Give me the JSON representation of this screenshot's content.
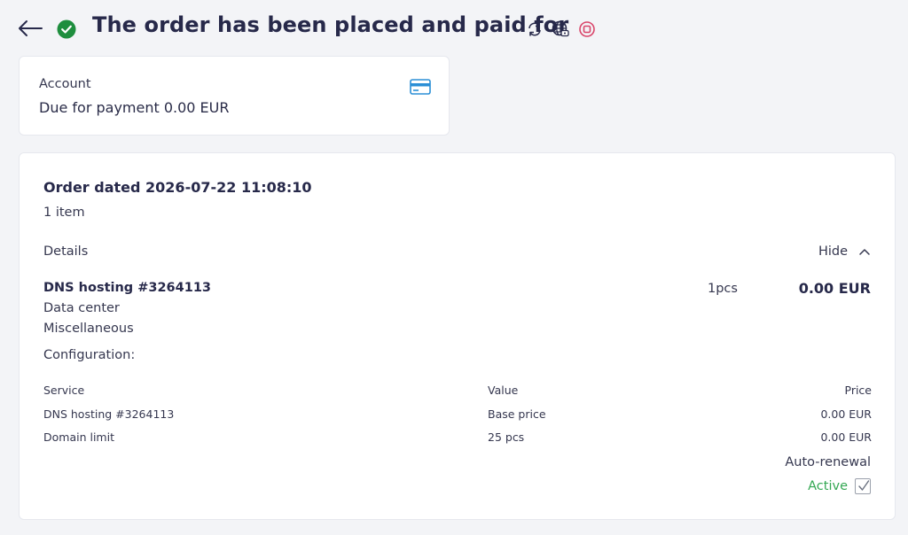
{
  "header": {
    "title": "The order has been placed and paid for",
    "icons": [
      "back-arrow-icon",
      "check-circle-icon",
      "refresh-icon",
      "globe-icon",
      "stop-circle-icon"
    ],
    "colors": {
      "success": "#1e8e3e",
      "danger": "#d9456a",
      "title": "#27294a"
    }
  },
  "account": {
    "label": "Account",
    "due": "Due for payment 0.00 EUR",
    "icon": "credit-card-icon"
  },
  "order": {
    "title": "Order dated 2026-07-22 11:08:10",
    "item_count": "1 item",
    "details_label": "Details",
    "hide_label": "Hide",
    "service": {
      "name": "DNS hosting #3264113",
      "quantity": "1pcs",
      "price": "0.00 EUR",
      "datacenter": "Data center",
      "misc": "Miscellaneous"
    },
    "configuration_label": "Configuration:",
    "table": {
      "headers": {
        "service": "Service",
        "value": "Value",
        "price": "Price"
      },
      "rows": [
        {
          "service": "DNS hosting #3264113",
          "value": "Base price",
          "price": "0.00 EUR"
        },
        {
          "service": "Domain limit",
          "value": "25 pcs",
          "price": "0.00 EUR"
        }
      ]
    },
    "auto_renewal": {
      "label": "Auto-renewal",
      "status": "Active",
      "checked": true,
      "color": "#34a853"
    }
  }
}
